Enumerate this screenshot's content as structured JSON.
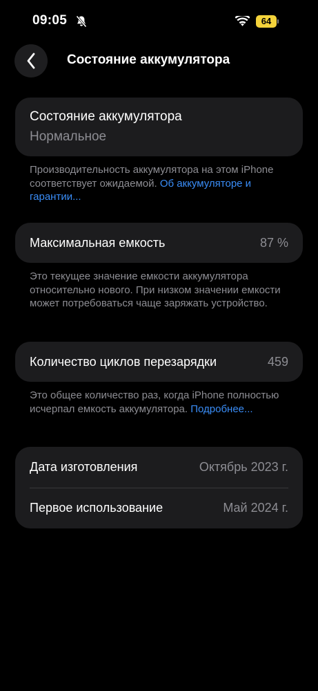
{
  "status_bar": {
    "time": "09:05",
    "battery_level": "64"
  },
  "nav": {
    "title": "Состояние аккумулятора"
  },
  "health": {
    "label": "Состояние аккумулятора",
    "value": "Нормальное",
    "note_text": "Производительность аккумулятора на этом iPhone соответствует ожидаемой. ",
    "note_link": "Об аккуму­ляторе и гарантии..."
  },
  "capacity": {
    "label": "Максимальная емкость",
    "value": "87 %",
    "note_text": "Это текущее значение емкости аккумулятора относительно нового. При низком значении емкости может потребоваться чаще заряжать устройство."
  },
  "cycles": {
    "label": "Количество циклов перезарядки",
    "value": "459",
    "note_text": "Это общее количество раз, когда iPhone полностью исчерпал емкость аккумулятора. ",
    "note_link": "Подробнее..."
  },
  "dates": {
    "manufactured_label": "Дата изготовления",
    "manufactured_value": "Октябрь 2023 г.",
    "first_use_label": "Первое использование",
    "first_use_value": "Май 2024 г."
  },
  "colors": {
    "background": "#000000",
    "card": "#1c1c1e",
    "secondary_text": "#8d8d93",
    "link": "#3a8df7",
    "battery": "#f4d33b"
  },
  "icons": [
    "bell-slash-icon",
    "wifi-icon",
    "battery-icon",
    "chevron-left-icon"
  ]
}
